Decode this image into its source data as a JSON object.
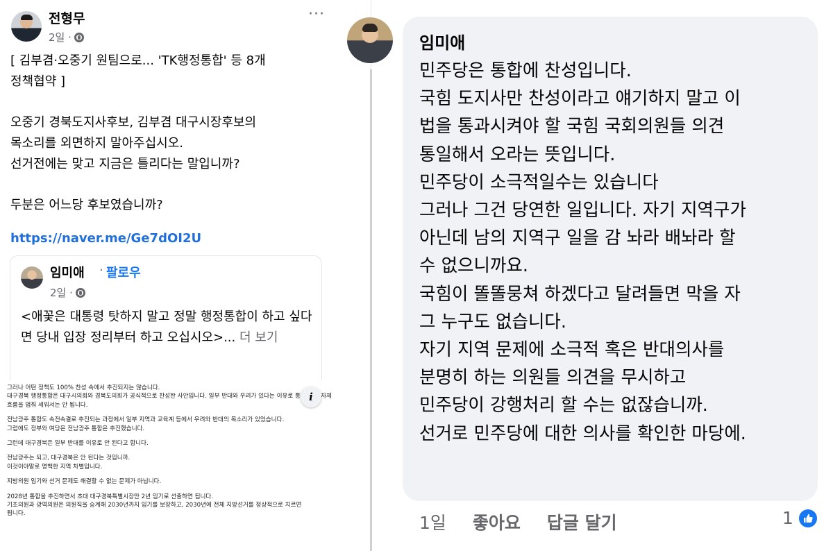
{
  "post": {
    "author": "전형무",
    "time": "2일 ·",
    "more_label": "···",
    "body": [
      "[ 김부겸·오중기 원팀으로... 'TK행정통합' 등 8개",
      "정책협약 ]",
      "",
      "오중기 경북도지사후보, 김부겸 대구시장후보의",
      "목소리를 외면하지 말아주십시오.",
      "선거전에는 맞고 지금은 틀리다는 말입니까?",
      "",
      "두분은 어느당 후보였습니까?"
    ],
    "link": "https://naver.me/Ge7dOI2U"
  },
  "shared_post": {
    "author": "임미애",
    "separator": "·",
    "follow_label": "팔로우",
    "time": "2일 ·",
    "text": "<애꽃은 대통령 탓하지 말고 정말 행정통합이 하고 싶다면 당내 입장 정리부터 하고 오십시오>...",
    "more_label": " 더 보기"
  },
  "document": {
    "lines": [
      "그러나 어떤 정책도 100% 찬성 속에서 추진되지는 않습니다.",
      "대구경북 행정통합은 대구시의회와 경북도의회가 공식적으로 찬성한 사안입니다. 일부 반대와 우려가 있다는 이유로 통합 추진 자체",
      "흐름을 멈춰 세워서는 안 됩니다.",
      "",
      "전남광주 통합도 속전속결로 추진되는 과정에서 일부 지역과 교육계 등에서 우려와 반대의 목소리가 있었습니다.",
      "그럼에도 정부와 여당은 전남광주 통합은 추진했습니다.",
      "",
      "그런데 대구경북은 일부 반대를 이유로 안 된다고 합니다.",
      "",
      "전남광주는 되고, 대구경북은 안 된다는 것입니까.",
      "이것이야말로 명백한 지역 차별입니다.",
      "",
      "지방의원 임기와 선거 문제도 해결할 수 없는 문제가 아닙니다.",
      "",
      "2028년 통합을 추진하면서 초대 대구경북특별시장만 2년 임기로 선출하면 됩니다.",
      "기초의원과 광역의원은 의원직을 승계해 2030년까지 임기를 보장하고, 2030년에 전체 지방선거를 정상적으로 치르면",
      "됩니다."
    ],
    "info_label": "i"
  },
  "comment": {
    "author": "임미애",
    "lines": [
      "민주당은 통합에 찬성입니다.",
      "국힘 도지사만 찬성이라고 얘기하지 말고 이",
      "법을 통과시켜야 할 국힘 국회의원들 의견",
      "통일해서 오라는 뜻입니다.",
      "민주당이 소극적일수는 있습니다",
      "그러나 그건 당연한 일입니다. 자기 지역구가",
      "아닌데 남의 지역구 일을 감 놔라 배놔라 할",
      "수 없으니까요.",
      "국힘이 똘똘뭉쳐 하겠다고 달려들면 막을 자",
      "그 누구도 없습니다.",
      "자기 지역 문제에 소극적 혹은 반대의사를",
      "분명히 하는 의원들 의견을 무시하고",
      "민주당이 강행처리 할 수는 없잖습니까.",
      "선거로 민주당에 대한 의사를 확인한 마당에."
    ],
    "time": "1일",
    "like_label": "좋아요",
    "reply_label": "답글 달기",
    "reaction_count": "1",
    "reaction_icon": "thumbs-up-icon",
    "accent": "#1877f2"
  }
}
